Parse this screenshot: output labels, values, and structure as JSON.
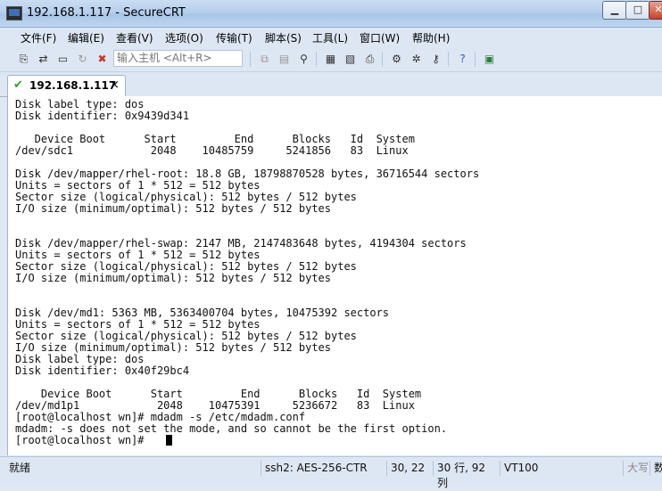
{
  "window": {
    "title": "192.168.1.117 - SecureCRT"
  },
  "menu": [
    "文件(F)",
    "编辑(E)",
    "查看(V)",
    "选项(O)",
    "传输(T)",
    "脚本(S)",
    "工具(L)",
    "窗口(W)",
    "帮助(H)"
  ],
  "toolbar": {
    "quick_connect_placeholder": "输入主机 <Alt+R>"
  },
  "tab": {
    "label": "192.168.1.117",
    "close": "×"
  },
  "terminal": {
    "lines": [
      "Disk label type: dos",
      "Disk identifier: 0x9439d341",
      "",
      "   Device Boot      Start         End      Blocks   Id  System",
      "/dev/sdc1            2048    10485759     5241856   83  Linux",
      "",
      "Disk /dev/mapper/rhel-root: 18.8 GB, 18798870528 bytes, 36716544 sectors",
      "Units = sectors of 1 * 512 = 512 bytes",
      "Sector size (logical/physical): 512 bytes / 512 bytes",
      "I/O size (minimum/optimal): 512 bytes / 512 bytes",
      "",
      "",
      "Disk /dev/mapper/rhel-swap: 2147 MB, 2147483648 bytes, 4194304 sectors",
      "Units = sectors of 1 * 512 = 512 bytes",
      "Sector size (logical/physical): 512 bytes / 512 bytes",
      "I/O size (minimum/optimal): 512 bytes / 512 bytes",
      "",
      "",
      "Disk /dev/md1: 5363 MB, 5363400704 bytes, 10475392 sectors",
      "Units = sectors of 1 * 512 = 512 bytes",
      "Sector size (logical/physical): 512 bytes / 512 bytes",
      "I/O size (minimum/optimal): 512 bytes / 512 bytes",
      "Disk label type: dos",
      "Disk identifier: 0x40f29bc4",
      "",
      "    Device Boot      Start         End      Blocks   Id  System",
      "/dev/md1p1            2048    10475391     5236672   83  Linux",
      "[root@localhost wn]# mdadm -s /etc/mdadm.conf",
      "mdadm: -s does not set the mode, and so cannot be the first option.",
      "[root@localhost wn]# "
    ]
  },
  "status": {
    "ready": "就绪",
    "protocol": "ssh2: AES-256-CTR",
    "position": "30,  22",
    "size": "30 行, 92 列",
    "terminal_type": "VT100",
    "caps": "大写",
    "num": "数"
  }
}
